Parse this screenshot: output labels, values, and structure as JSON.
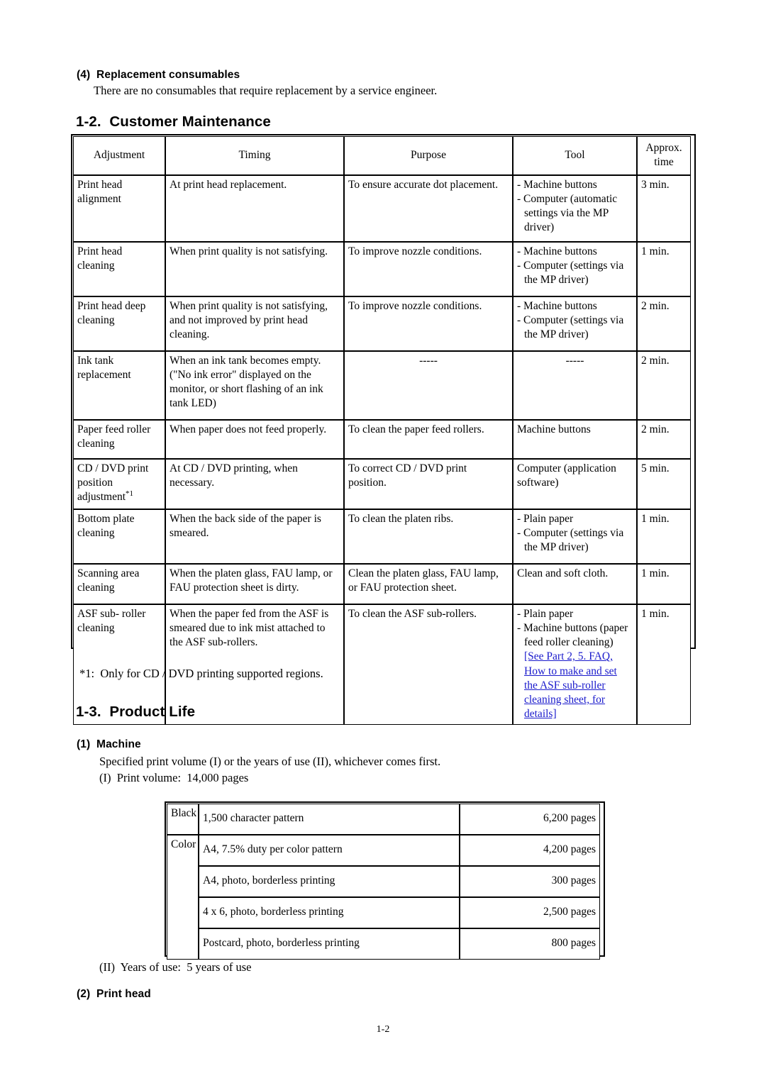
{
  "section_4": {
    "heading": "(4)  Replacement consumables",
    "body": "There are no consumables that require replacement by a service engineer."
  },
  "section_1_2": {
    "heading": "1-2.  Customer Maintenance",
    "footnote": "*1:  Only for CD / DVD printing supported regions.",
    "table": {
      "headers": [
        "Adjustment",
        "Timing",
        "Purpose",
        "Tool",
        "Approx.\ntime"
      ],
      "rows": [
        {
          "adjustment": [
            "Print head",
            "alignment"
          ],
          "timing": [
            "At print head replacement."
          ],
          "purpose": [
            "To ensure accurate dot placement."
          ],
          "tool": [
            "- Machine buttons",
            "- Computer (automatic",
            "settings via the MP",
            "driver)"
          ],
          "tool_indent": [
            false,
            false,
            true,
            true
          ],
          "time": "3 min."
        },
        {
          "adjustment": [
            "Print head",
            "cleaning"
          ],
          "timing": [
            "When print quality is not satisfying."
          ],
          "purpose": [
            "To improve nozzle conditions."
          ],
          "tool": [
            "- Machine buttons",
            "- Computer (settings via",
            "the MP driver)"
          ],
          "tool_indent": [
            false,
            false,
            true
          ],
          "time": "1 min."
        },
        {
          "adjustment": [
            "Print head deep",
            "cleaning"
          ],
          "timing": [
            "When print quality is not satisfying,",
            "and not improved by print head",
            "cleaning."
          ],
          "purpose": [
            "To improve nozzle conditions."
          ],
          "tool": [
            "- Machine buttons",
            "- Computer (settings via",
            "the MP driver)"
          ],
          "tool_indent": [
            false,
            false,
            true
          ],
          "time": "2 min."
        },
        {
          "adjustment": [
            "Ink tank",
            "replacement"
          ],
          "timing": [
            "When an ink tank becomes empty.",
            "(\"No ink error\" displayed on the",
            "monitor, or short flashing of an ink",
            "tank LED)"
          ],
          "purpose": [
            "-----"
          ],
          "purpose_center": true,
          "tool": [
            "-----"
          ],
          "tool_center": true,
          "time": "2 min."
        },
        {
          "adjustment": [
            "Paper feed roller",
            "cleaning"
          ],
          "timing": [
            "When paper does not feed properly."
          ],
          "purpose": [
            "To clean the paper feed rollers."
          ],
          "tool": [
            "Machine buttons"
          ],
          "tool_indent": [
            false
          ],
          "time": "2 min."
        },
        {
          "adjustment": [
            "CD / DVD print",
            "position",
            "adjustment*1"
          ],
          "adjustment_sup_last": "*1",
          "timing": [
            "At CD / DVD printing, when",
            "necessary."
          ],
          "purpose": [
            "To correct CD / DVD print",
            "position."
          ],
          "tool": [
            "Computer (application",
            "software)"
          ],
          "tool_indent": [
            false,
            false
          ],
          "time": "5 min."
        },
        {
          "adjustment": [
            "Bottom plate",
            "cleaning"
          ],
          "timing": [
            "When the back side of the paper is",
            "smeared."
          ],
          "purpose": [
            "To clean the platen ribs."
          ],
          "tool": [
            "- Plain paper",
            "- Computer (settings via",
            "the MP driver)"
          ],
          "tool_indent": [
            false,
            false,
            true
          ],
          "time": "1 min."
        },
        {
          "adjustment": [
            "Scanning area",
            "cleaning"
          ],
          "timing": [
            "When the platen glass, FAU lamp, or",
            "FAU protection sheet is dirty."
          ],
          "purpose": [
            "Clean the platen glass, FAU lamp,",
            "or FAU protection sheet."
          ],
          "tool": [
            "Clean and soft cloth."
          ],
          "tool_indent": [
            false
          ],
          "time": "1 min."
        },
        {
          "adjustment": [
            "ASF sub- roller",
            "cleaning"
          ],
          "timing": [
            "When the paper fed from the ASF is",
            "smeared due to ink mist attached to",
            "the ASF sub-rollers."
          ],
          "purpose": [
            "To clean the ASF sub-rollers."
          ],
          "tool": [
            "- Plain paper",
            "- Machine buttons (paper",
            "feed roller cleaning)"
          ],
          "tool_indent": [
            false,
            false,
            true
          ],
          "tool_link": [
            "[See Part 2, 5. FAQ,",
            "How to make and set",
            "the ASF sub-roller",
            "cleaning sheet, for",
            "details]"
          ],
          "time": "1 min."
        }
      ]
    }
  },
  "section_1_3": {
    "heading": "1-3.  Product Life",
    "machine": {
      "heading": "(1)  Machine",
      "line1": "Specified print volume (I) or the years of use (II), whichever comes first.",
      "line2": "(I)  Print volume:  14,000 pages",
      "line3": "(II)  Years of use:  5 years of use",
      "table": {
        "groups": [
          {
            "label": "Black",
            "span": 1
          },
          {
            "label": "Color",
            "span": 4
          }
        ],
        "rows": [
          {
            "group": "Black",
            "pattern": "1,500 character pattern",
            "pages": "6,200 pages"
          },
          {
            "group": "Color",
            "pattern": "A4, 7.5% duty per color pattern",
            "pages": "4,200 pages"
          },
          {
            "group": "Color",
            "pattern": "A4, photo, borderless printing",
            "pages": "300 pages"
          },
          {
            "group": "Color",
            "pattern": "4 x 6, photo, borderless printing",
            "pages": "2,500 pages"
          },
          {
            "group": "Color",
            "pattern": "Postcard, photo, borderless printing",
            "pages": "800 pages"
          }
        ]
      }
    },
    "print_head": {
      "heading": "(2)  Print head"
    }
  },
  "footer": {
    "page_number": "1-2"
  },
  "colors": {
    "link": "#1a1acc",
    "text": "#000000",
    "rule": "#000000"
  }
}
